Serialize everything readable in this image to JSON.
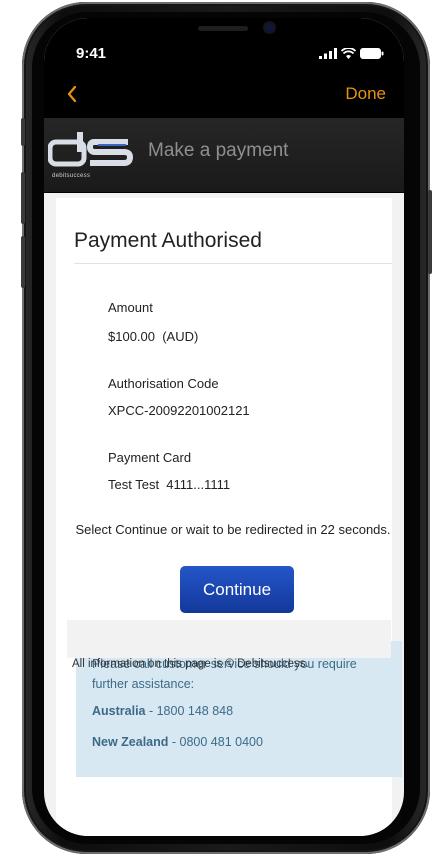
{
  "status_bar": {
    "time": "9:41"
  },
  "nav": {
    "done_label": "Done"
  },
  "brand": {
    "logo_text": "ds",
    "logo_subtext": "debitsuccess",
    "page_title": "Make a payment"
  },
  "receipt": {
    "title": "Payment Authorised",
    "amount_label": "Amount",
    "amount_value": "$100.00  (AUD)",
    "auth_code_label": "Authorisation Code",
    "auth_code_value": "XPCC-20092201002121",
    "card_label": "Payment Card",
    "card_value": "Test Test  4111...1111",
    "redirect_message": "Select Continue or wait to be redirected in 22 seconds.",
    "continue_label": "Continue"
  },
  "help": {
    "message": "Please call customer service should you require further assistance:",
    "au_label": "Australia",
    "au_phone": " - 1800 148 848",
    "nz_label": "New Zealand",
    "nz_phone": " - 0800 481 0400"
  },
  "footer": {
    "text": "All information on this page is © Debitsuccess."
  },
  "colors": {
    "accent": "#e8940e",
    "button": "#1e4bbd",
    "info_bg": "#d7e8f2",
    "info_text": "#3c6a88"
  }
}
